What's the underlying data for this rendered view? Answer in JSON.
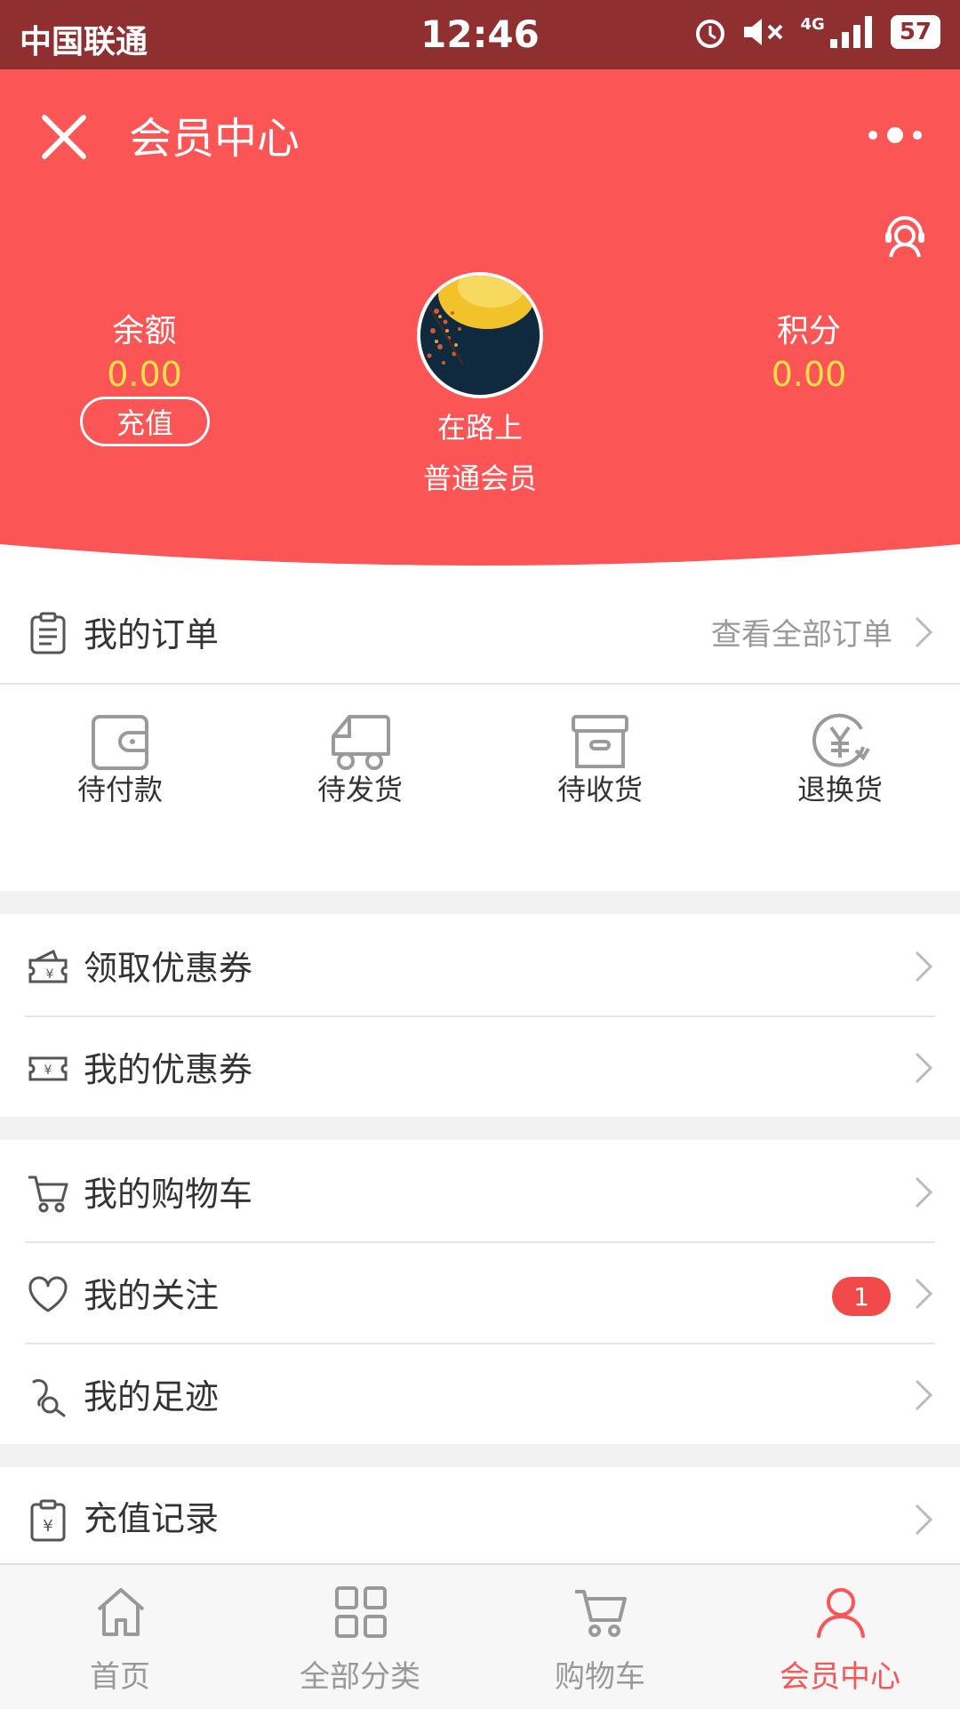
{
  "status_bar": {
    "carrier": "中国联通",
    "time": "12:46",
    "battery": "57",
    "network": "4G"
  },
  "header": {
    "title": "会员中心"
  },
  "profile": {
    "balance_label": "余额",
    "balance_value": "0.00",
    "recharge_label": "充值",
    "points_label": "积分",
    "points_value": "0.00",
    "nickname": "在路上",
    "level": "普通会员"
  },
  "orders": {
    "title": "我的订单",
    "view_all": "查看全部订单",
    "statuses": [
      {
        "label": "待付款",
        "icon": "wallet-icon"
      },
      {
        "label": "待发货",
        "icon": "truck-icon"
      },
      {
        "label": "待收货",
        "icon": "box-icon"
      },
      {
        "label": "退换货",
        "icon": "yuan-refresh-icon"
      }
    ]
  },
  "menu": [
    {
      "label": "领取优惠券",
      "icon": "coupon-get-icon"
    },
    {
      "label": "我的优惠券",
      "icon": "coupon-icon"
    },
    {
      "label": "我的购物车",
      "icon": "cart-icon"
    },
    {
      "label": "我的关注",
      "icon": "heart-icon",
      "badge": "1"
    },
    {
      "label": "我的足迹",
      "icon": "footprint-icon"
    },
    {
      "label": "充值记录",
      "icon": "clipboard-yuan-icon"
    }
  ],
  "tabbar": [
    {
      "label": "首页",
      "icon": "home-icon"
    },
    {
      "label": "全部分类",
      "icon": "grid-icon"
    },
    {
      "label": "购物车",
      "icon": "cart-icon"
    },
    {
      "label": "会员中心",
      "icon": "user-icon",
      "active": true
    }
  ],
  "colors": {
    "primary": "#fc5555",
    "accent_value": "#ffe04a",
    "statusbar": "#8f2f2f"
  }
}
